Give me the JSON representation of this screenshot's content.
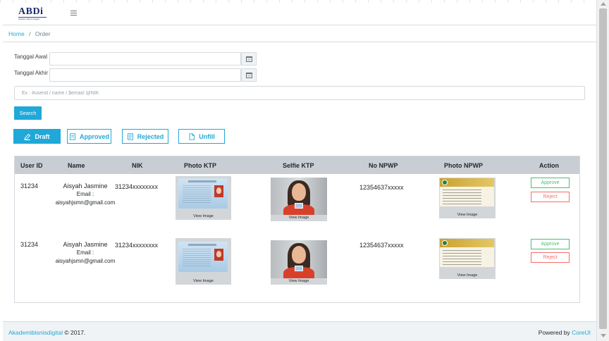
{
  "brand": {
    "logo_text": "ABDi",
    "logo_tagline": "Akademi Bisnis Digital"
  },
  "breadcrumb": {
    "home": "Home",
    "separator": "/",
    "current": "Order"
  },
  "filters": {
    "start_date_label": "Tanggal Awal",
    "end_date_label": "Tanggal Akhir",
    "start_date_value": "",
    "end_date_value": "",
    "search_placeholder": "Ex : #userid / name / $email/ @NIK",
    "search_value": "",
    "search_button": "Search"
  },
  "tabs": [
    {
      "label": "Draft",
      "icon": "pen-icon",
      "active": true
    },
    {
      "label": "Approved",
      "icon": "document-icon",
      "active": false
    },
    {
      "label": "Rejected",
      "icon": "list-document-icon",
      "active": false
    },
    {
      "label": "Unfill",
      "icon": "blank-file-icon",
      "active": false
    }
  ],
  "table": {
    "columns": [
      "User ID",
      "Name",
      "NIK",
      "Photo KTP",
      "Selfie KTP",
      "No NPWP",
      "Photo NPWP",
      "Action"
    ],
    "rows": [
      {
        "user_id": "31234",
        "name": "Aisyah Jasmine",
        "email_label": "Email :",
        "email": "aisyahjsmn@gmail.com",
        "nik": "31234xxxxxxxx",
        "no_npwp": "12354637xxxxx",
        "view_image": "View Image",
        "approve": "Approve",
        "reject": "Reject"
      },
      {
        "user_id": "31234",
        "name": "Aisyah Jasmine",
        "email_label": "Email :",
        "email": "aisyahjsmn@gmail.com",
        "nik": "31234xxxxxxxx",
        "no_npwp": "12354637xxxxx",
        "view_image": "View Image",
        "approve": "Approve",
        "reject": "Reject"
      }
    ]
  },
  "footer": {
    "brand_link": "Akademibisnisdigital",
    "copyright": "© 2017.",
    "powered_by": "Powered by",
    "core_link": "CoreUI"
  },
  "colors": {
    "primary": "#20a8d8",
    "success": "#4dbd74",
    "danger": "#f86c6b",
    "table_header": "#c8ced3",
    "footer_bg": "#f0f3f5"
  }
}
